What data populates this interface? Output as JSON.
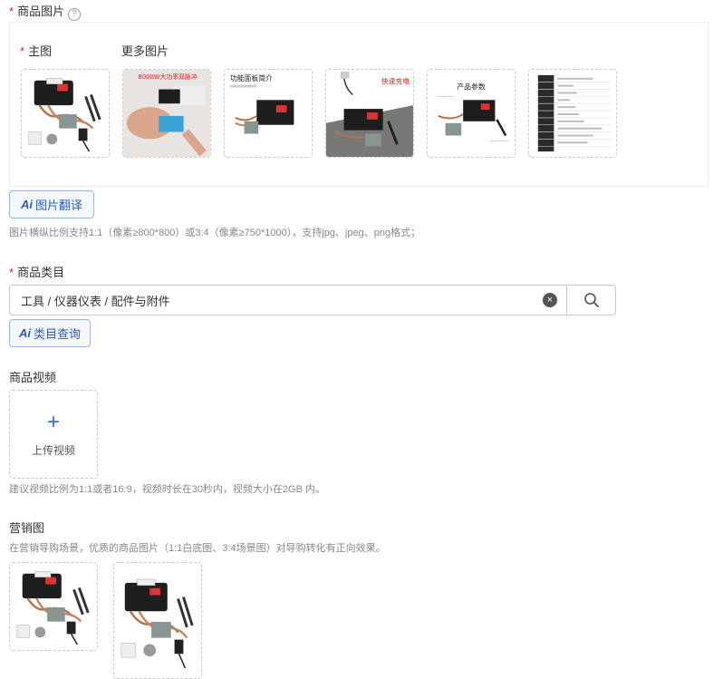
{
  "product_images": {
    "required_mark": "*",
    "label": "商品图片",
    "help_icon": "?",
    "main_label": "主图",
    "more_label": "更多图片",
    "thumbnails": [
      {
        "kind": "main-product",
        "caption": ""
      },
      {
        "kind": "banner",
        "caption": "8000W大功率双脉冲"
      },
      {
        "kind": "panel-intro",
        "caption": "功能面板简介"
      },
      {
        "kind": "fast-charge",
        "caption": "快速充电"
      },
      {
        "kind": "params",
        "caption": "产品参数"
      },
      {
        "kind": "spec-table",
        "caption": ""
      }
    ],
    "translate_button": {
      "ai": "Ai",
      "label": "图片翻译"
    },
    "hint": "图片横纵比例支持1:1（像素≥800*800）或3:4（像素≥750*1000），支持jpg、jpeg、png格式；"
  },
  "category": {
    "required_mark": "*",
    "label": "商品类目",
    "value": "工具 / 仪器仪表 / 配件与附件",
    "clear_icon": "×",
    "query_button": {
      "ai": "Ai",
      "label": "类目查询"
    }
  },
  "video": {
    "label": "商品视频",
    "plus": "+",
    "upload_label": "上传视频",
    "hint": "建议视频比例为1:1或者16:9，视频时长在30秒内，视频大小在2GB 内。"
  },
  "marketing": {
    "label": "营销图",
    "hint": "在营销导购场景，优质的商品图片（1:1白底图、3:4场景图）对导购转化有正向效果。"
  }
}
